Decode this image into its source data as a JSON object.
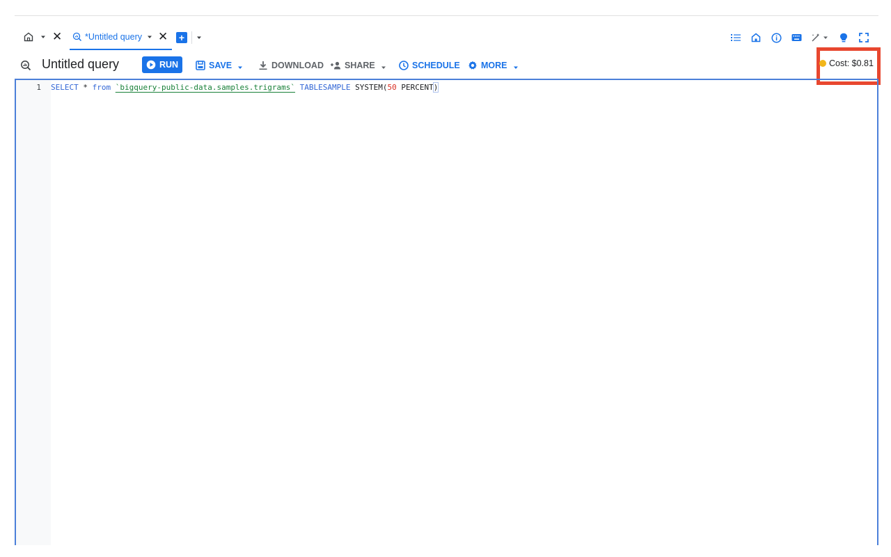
{
  "tabs": {
    "query_tab_label": "*Untitled query"
  },
  "toolbar": {
    "title": "Untitled query",
    "run": "RUN",
    "save": "SAVE",
    "download": "DOWNLOAD",
    "share": "SHARE",
    "schedule": "SCHEDULE",
    "more": "MORE",
    "cost": "Cost: $0.81"
  },
  "editor": {
    "line_number": "1",
    "tokens": {
      "select": "SELECT",
      "star": " * ",
      "from": "from",
      "space1": " ",
      "table": "`bigquery-public-data.samples.trigrams`",
      "space2": " ",
      "tablesample": "TABLESAMPLE",
      "system": " SYSTEM(",
      "fifty": "50",
      "percent": " PERCENT",
      "close": ")"
    }
  },
  "icons": {
    "home_tab": "home-icon",
    "query_tab": "query-icon",
    "new_tab": "add-tab-icon",
    "right": [
      "list-icon",
      "home-icon",
      "info-icon",
      "keyboard-icon",
      "magic-wand-icon",
      "lightbulb-icon",
      "fullscreen-icon"
    ]
  },
  "colors": {
    "accent": "#1a73e8",
    "highlight_box": "#e8472f",
    "cost_status": "#f2b61a"
  }
}
